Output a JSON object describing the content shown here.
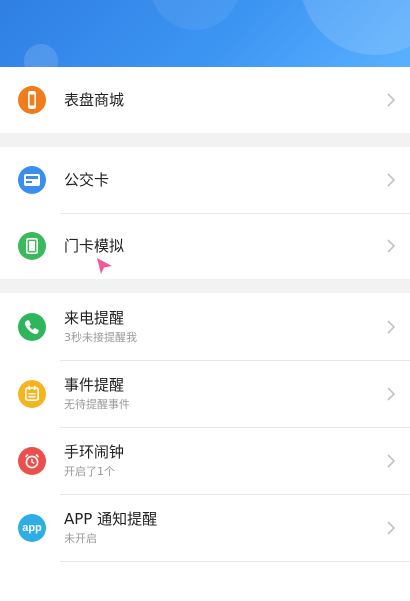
{
  "sections": [
    {
      "items": [
        {
          "id": "watch-face-store",
          "title": "表盘商城",
          "icon": "watch-icon",
          "color": "#f07d1b"
        }
      ]
    },
    {
      "items": [
        {
          "id": "transit-card",
          "title": "公交卡",
          "icon": "bus-card-icon",
          "color": "#3a8ef0"
        },
        {
          "id": "door-card",
          "title": "门卡模拟",
          "icon": "door-card-icon",
          "color": "#3cb95a"
        }
      ]
    },
    {
      "items": [
        {
          "id": "call-reminder",
          "title": "来电提醒",
          "subtitle": "3秒未接提醒我",
          "icon": "phone-icon",
          "color": "#2fb55c"
        },
        {
          "id": "event-reminder",
          "title": "事件提醒",
          "subtitle": "无待提醒事件",
          "icon": "calendar-icon",
          "color": "#f5b521"
        },
        {
          "id": "band-alarm",
          "title": "手环闹钟",
          "subtitle": "开启了1个",
          "icon": "alarm-clock-icon",
          "color": "#ea4f4b"
        },
        {
          "id": "app-notifications",
          "title": "APP 通知提醒",
          "subtitle": "未开启",
          "icon": "app-icon",
          "icon_text": "app",
          "color": "#2eaee6"
        }
      ]
    }
  ]
}
